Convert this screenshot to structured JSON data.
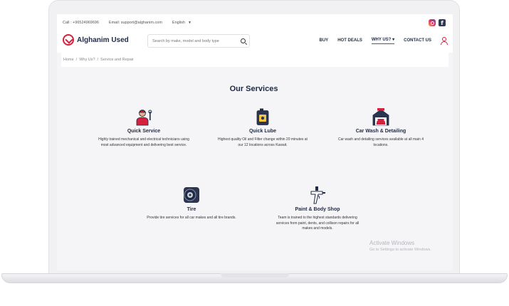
{
  "topbar": {
    "call": "Call : +96524969696",
    "email": "Email: support@alghanim.com",
    "language": "English"
  },
  "header": {
    "brand": "Alghanim Used",
    "search_placeholder": "Search by make, model and body type",
    "nav": {
      "buy": "BUY",
      "hot_deals": "HOT DEALS",
      "why_us": "WHY US? ▾",
      "contact_us": "CONTACT US"
    }
  },
  "breadcrumb": {
    "home": "Home",
    "sep1": "/",
    "why_us": "Why Us?",
    "sep2": "/",
    "current": "Service and Repair"
  },
  "main": {
    "heading": "Our Services",
    "services": [
      {
        "icon": "mechanic-icon",
        "title": "Quick Service",
        "desc": "Highly trained mechanical and electrical technicians using most advanced equipment and delivering best service."
      },
      {
        "icon": "oil-can-icon",
        "title": "Quick Lube",
        "desc": "Highest quality Oil and Filter change within 20 minutes at our 12 locations across Kuwait."
      },
      {
        "icon": "car-wash-icon",
        "title": "Car Wash & Detailing",
        "desc": "Car wash and detailing services available at all main 4 locations."
      },
      {
        "icon": "tire-icon",
        "title": "Tire",
        "desc": "Provide tire services for all car makes and all tire brands."
      },
      {
        "icon": "spray-gun-icon",
        "title": "Paint & Body Shop",
        "desc": "Team is trained to the highest standards delivering services from paint, dents, and collison repairs for all makes and models."
      }
    ]
  },
  "watermark": {
    "line1": "Activate Windows",
    "line2": "Go to Settings to activate Windows."
  },
  "colors": {
    "accent": "#d4213d",
    "navy": "#1f2a44",
    "panel": "#f5f5f7"
  }
}
